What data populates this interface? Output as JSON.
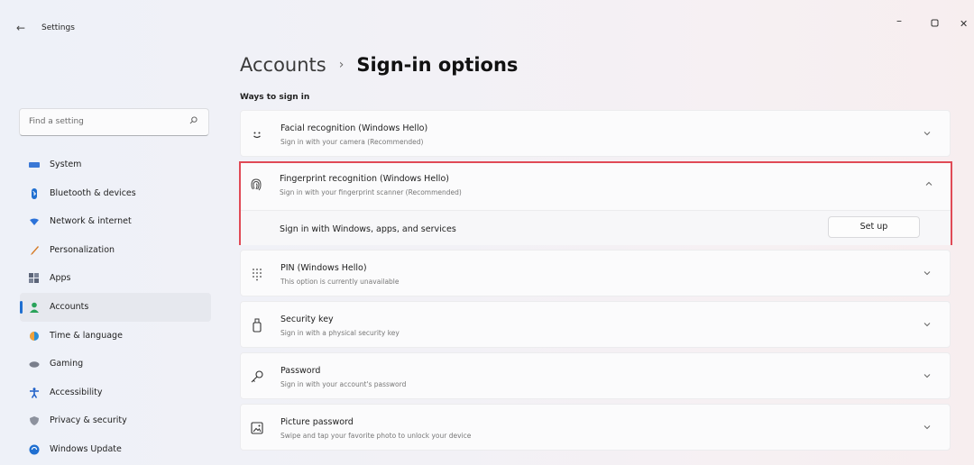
{
  "window": {
    "title": "Settings",
    "back_icon": "back-arrow-icon",
    "controls": {
      "minimize": "–",
      "maximize": "▢",
      "close": "✕"
    }
  },
  "search": {
    "placeholder": "Find a setting",
    "icon": "search-icon"
  },
  "sidebar": {
    "items": [
      {
        "label": "System",
        "icon": "system-icon",
        "color": "#3a78d6"
      },
      {
        "label": "Bluetooth & devices",
        "icon": "bluetooth-icon",
        "color": "#1f6fd1"
      },
      {
        "label": "Network & internet",
        "icon": "network-icon",
        "color": "#2b72d9"
      },
      {
        "label": "Personalization",
        "icon": "personalization-icon",
        "color": "#d57a25"
      },
      {
        "label": "Apps",
        "icon": "apps-icon",
        "color": "#5b6478"
      },
      {
        "label": "Accounts",
        "icon": "accounts-icon",
        "color": "#2aa35a",
        "active": true
      },
      {
        "label": "Time & language",
        "icon": "time-language-icon",
        "color": "#2b8fd6"
      },
      {
        "label": "Gaming",
        "icon": "gaming-icon",
        "color": "#7a7f8c"
      },
      {
        "label": "Accessibility",
        "icon": "accessibility-icon",
        "color": "#1d5fc8"
      },
      {
        "label": "Privacy & security",
        "icon": "privacy-icon",
        "color": "#7a7f8c"
      },
      {
        "label": "Windows Update",
        "icon": "windows-update-icon",
        "color": "#1f6fd1"
      }
    ]
  },
  "header": {
    "parent": "Accounts",
    "separator": "›",
    "current": "Sign-in options"
  },
  "section_label": "Ways to sign in",
  "options": {
    "facial": {
      "title": "Facial recognition (Windows Hello)",
      "subtitle": "Sign in with your camera (Recommended)",
      "icon": "face-icon"
    },
    "fingerprint": {
      "title": "Fingerprint recognition (Windows Hello)",
      "subtitle": "Sign in with your fingerprint scanner (Recommended)",
      "icon": "fingerprint-icon",
      "expanded_row": "Sign in with Windows, apps, and services",
      "button": "Set up",
      "highlight_color": "#e04a56"
    },
    "pin": {
      "title": "PIN (Windows Hello)",
      "subtitle": "This option is currently unavailable",
      "icon": "pin-keypad-icon"
    },
    "security_key": {
      "title": "Security key",
      "subtitle": "Sign in with a physical security key",
      "icon": "usb-key-icon"
    },
    "password": {
      "title": "Password",
      "subtitle": "Sign in with your account's password",
      "icon": "key-icon"
    },
    "picture_password": {
      "title": "Picture password",
      "subtitle": "Swipe and tap your favorite photo to unlock your device",
      "icon": "picture-icon"
    }
  }
}
